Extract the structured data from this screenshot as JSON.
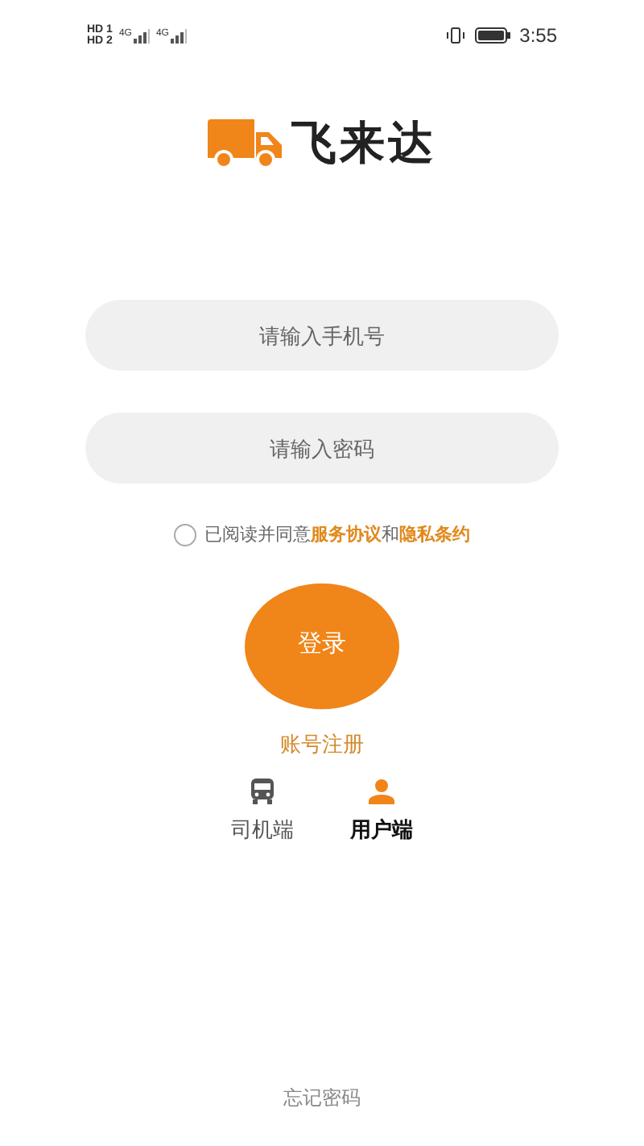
{
  "status_bar": {
    "sim_1": "HD 1",
    "sim_2": "HD 2",
    "network_1": "4G",
    "network_2": "4G",
    "time": "3:55"
  },
  "app_name": "飞来达",
  "phone_field": {
    "placeholder": "请输入手机号"
  },
  "password_field": {
    "placeholder": "请输入密码"
  },
  "agreement": {
    "checked": false,
    "text": "已阅读并同意",
    "link_1": "服务协议",
    "joiner": "和",
    "link_2": "隐私条约"
  },
  "login_button": "登录",
  "register_link": "账号注册",
  "roles": [
    {
      "kind": "driver",
      "label": "司机端",
      "selected": false
    },
    {
      "kind": "user",
      "label": "用户端",
      "selected": true
    }
  ],
  "forgot_password": "忘记密码"
}
